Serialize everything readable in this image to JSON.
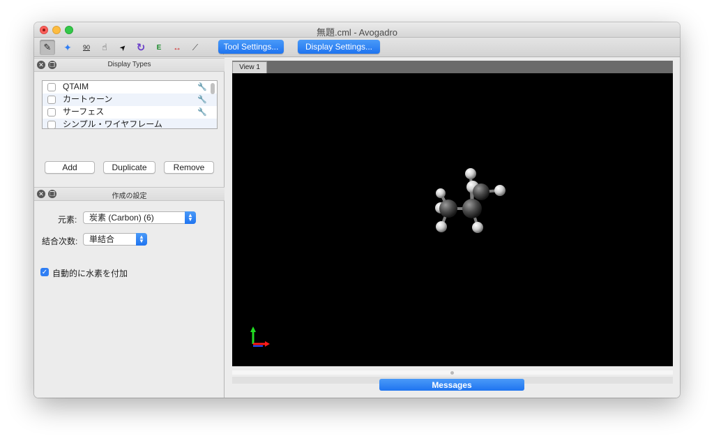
{
  "window": {
    "title": "無題.cml - Avogadro"
  },
  "toolbar": {
    "tools": [
      {
        "icon": "draw-pencil-icon",
        "glyph": "✎",
        "active": true
      },
      {
        "icon": "navigate-icon",
        "glyph": "✦"
      },
      {
        "icon": "measure-angle-icon",
        "glyph": "90"
      },
      {
        "icon": "manipulate-hand-icon",
        "glyph": "☝"
      },
      {
        "icon": "select-arrow-icon",
        "glyph": "➤"
      },
      {
        "icon": "rotate-icon",
        "glyph": "↻"
      },
      {
        "icon": "auto-optimize-icon",
        "glyph": "E"
      },
      {
        "icon": "ruler-measure-icon",
        "glyph": "↔"
      },
      {
        "icon": "align-icon",
        "glyph": "⟋"
      }
    ],
    "tool_settings_label": "Tool Settings...",
    "display_settings_label": "Display Settings..."
  },
  "display_types": {
    "title": "Display Types",
    "items": [
      {
        "label": "QTAIM",
        "checked": false,
        "has_settings": true
      },
      {
        "label": "カートゥーン",
        "checked": false,
        "has_settings": true
      },
      {
        "label": "サーフェス",
        "checked": false,
        "has_settings": true
      },
      {
        "label": "シンプル・ワイヤフレーム",
        "checked": false,
        "has_settings": false
      }
    ],
    "add_label": "Add",
    "duplicate_label": "Duplicate",
    "remove_label": "Remove"
  },
  "build_settings": {
    "title": "作成の設定",
    "element_label": "元素:",
    "element_value": "炭素 (Carbon) (6)",
    "bond_order_label": "結合次数:",
    "bond_order_value": "単結合",
    "auto_hydrogen_label": "自動的に水素を付加",
    "auto_hydrogen_checked": true
  },
  "view": {
    "tab_label": "View 1"
  },
  "messages_label": "Messages",
  "colors": {
    "accent": "#1f74f0",
    "viewport_bg": "#000000",
    "axis_x": "#ff1a1a",
    "axis_y": "#22dd22",
    "axis_z": "#2a4bff"
  }
}
